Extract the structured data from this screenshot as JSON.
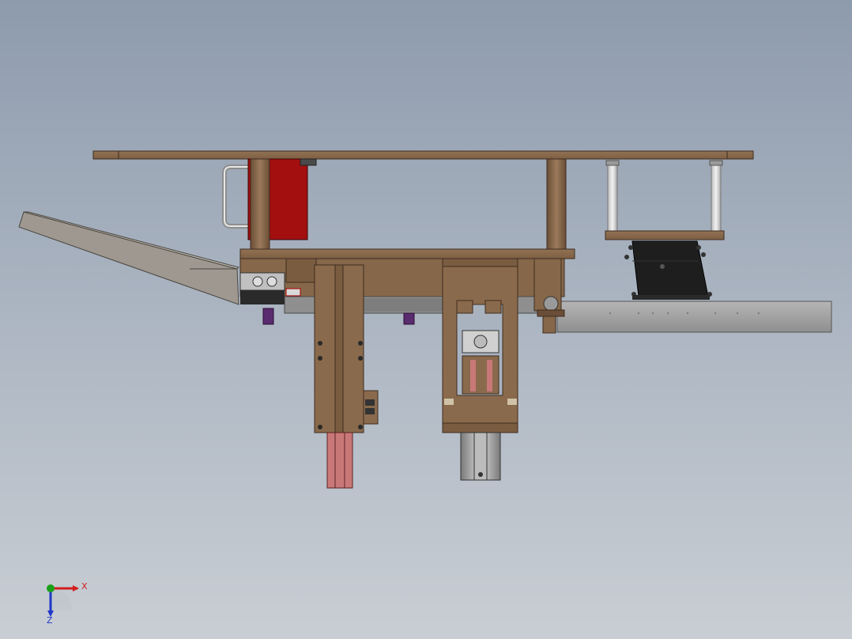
{
  "viewport": {
    "background_top": "#8e9bad",
    "background_bottom": "#c9ced4"
  },
  "model": {
    "colors": {
      "wood": "#8a6a4c",
      "wood_dark": "#5e4632",
      "red_block": "#a30f0f",
      "steel": "#a7a7a7",
      "chute": "#9e9890",
      "black_part": "#222222",
      "purple_part": "#5a2b6e",
      "pink_rod": "#c97878"
    }
  },
  "triad": {
    "x_label": "X",
    "z_label": "Z",
    "x_color": "#d21e1e",
    "y_color": "#1aa01a",
    "z_color": "#1f37c7"
  }
}
